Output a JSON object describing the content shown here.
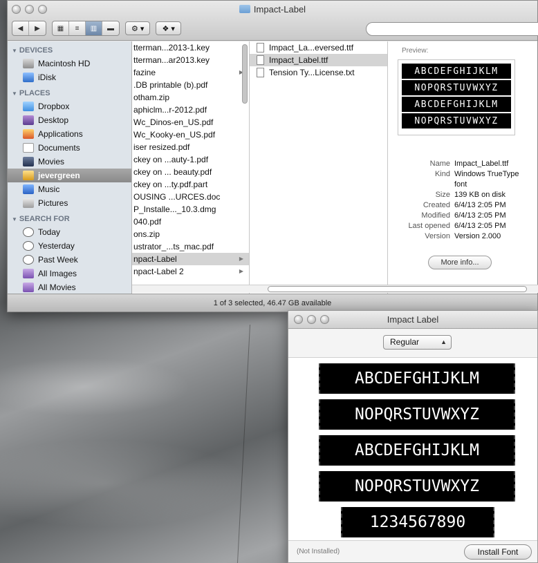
{
  "finder": {
    "title": "Impact-Label",
    "toolbar": {
      "back": "◀",
      "forward": "▶",
      "views": [
        "▦",
        "≡",
        "▥",
        "▬"
      ],
      "action": "⚙ ▾",
      "dropbox": "❖ ▾"
    },
    "search_placeholder": "",
    "sidebar": {
      "devices_header": "DEVICES",
      "devices": [
        "Macintosh HD",
        "iDisk"
      ],
      "places_header": "PLACES",
      "places": [
        "Dropbox",
        "Desktop",
        "Applications",
        "Documents",
        "Movies",
        "jevergreen",
        "Music",
        "Pictures"
      ],
      "search_header": "SEARCH FOR",
      "searches": [
        "Today",
        "Yesterday",
        "Past Week",
        "All Images",
        "All Movies"
      ]
    },
    "column1": [
      "tterman...2013-1.key",
      "tterman...ar2013.key",
      "fazine",
      ".DB printable (b).pdf",
      "otham.zip",
      "aphiclm...r-2012.pdf",
      "Wc_Dinos-en_US.pdf",
      "Wc_Kooky-en_US.pdf",
      "iser resized.pdf",
      "ckey on ...auty-1.pdf",
      "ckey on ... beauty.pdf",
      "ckey on ...ty.pdf.part",
      "OUSING ...URCES.doc",
      "P_Installe..._10.3.dmg",
      "040.pdf",
      "ons.zip",
      "ustrator_...ts_mac.pdf",
      "npact-Label",
      "npact-Label 2"
    ],
    "column2": [
      "Impact_La...eversed.ttf",
      "Impact_Label.ttf",
      "Tension Ty...License.txt"
    ],
    "preview": {
      "label": "Preview:",
      "lines": [
        "ABCDEFGHIJKLM",
        "NOPQRSTUVWXYZ",
        "ABCDEFGHIJKLM",
        "NOPQRSTUVWXYZ"
      ],
      "info": [
        {
          "k": "Name",
          "v": "Impact_Label.ttf"
        },
        {
          "k": "Kind",
          "v": "Windows TrueType font"
        },
        {
          "k": "Size",
          "v": "139 KB on disk"
        },
        {
          "k": "Created",
          "v": "6/4/13 2:05 PM"
        },
        {
          "k": "Modified",
          "v": "6/4/13 2:05 PM"
        },
        {
          "k": "Last opened",
          "v": "6/4/13 2:05 PM"
        },
        {
          "k": "Version",
          "v": "Version 2.000"
        }
      ],
      "more_info": "More info..."
    },
    "status": "1 of 3 selected, 46.47 GB available"
  },
  "fontbook": {
    "title": "Impact Label",
    "style": "Regular",
    "samples": [
      "ABCDEFGHIJKLM",
      "NOPQRSTUVWXYZ",
      "ABCDEFGHIJKLM",
      "NOPQRSTUVWXYZ",
      "1234567890"
    ],
    "status_note": "(Not Installed)",
    "install_button": "Install Font"
  }
}
